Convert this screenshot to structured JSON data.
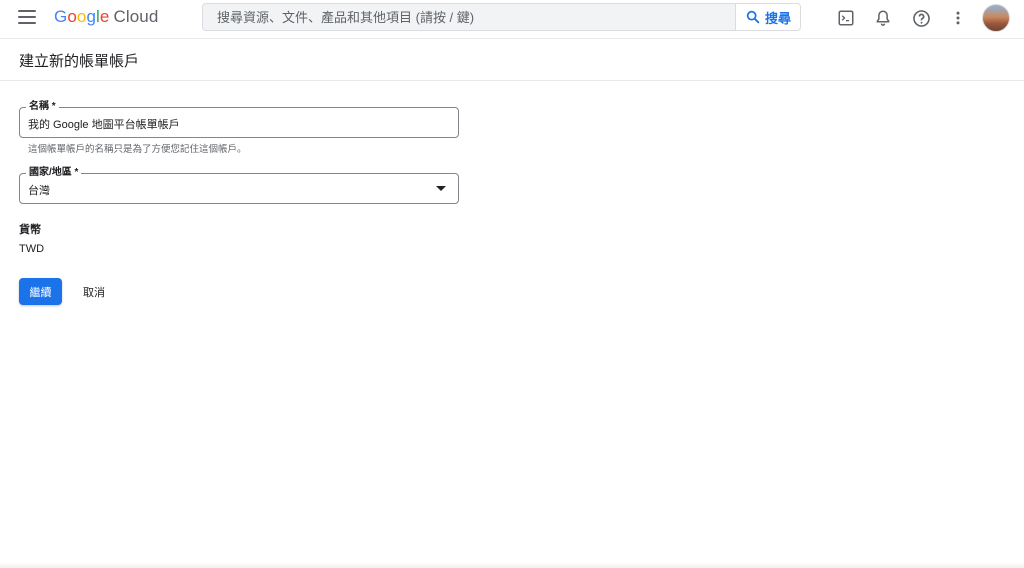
{
  "header": {
    "logo": {
      "letters": [
        "G",
        "o",
        "o",
        "g",
        "l",
        "e"
      ],
      "suffix": "Cloud"
    },
    "search": {
      "placeholder": "搜尋資源、文件、產品和其他項目 (請按 / 鍵)",
      "button_label": "搜尋"
    },
    "icons": [
      "menu-icon",
      "terminal-icon",
      "bell-icon",
      "help-icon",
      "more-vert-icon",
      "avatar"
    ]
  },
  "page": {
    "title": "建立新的帳單帳戶"
  },
  "form": {
    "name": {
      "label": "名稱 *",
      "value": "我的 Google 地圖平台帳單帳戶",
      "hint": "這個帳單帳戶的名稱只是為了方便您記住這個帳戶。"
    },
    "country": {
      "label": "國家/地區 *",
      "value": "台灣"
    },
    "currency": {
      "label": "貨幣",
      "value": "TWD"
    }
  },
  "actions": {
    "continue_label": "繼續",
    "cancel_label": "取消"
  },
  "colors": {
    "primary": "#1a73e8",
    "border": "#80868b",
    "text": "#202124",
    "secondary_text": "#5f6368"
  }
}
